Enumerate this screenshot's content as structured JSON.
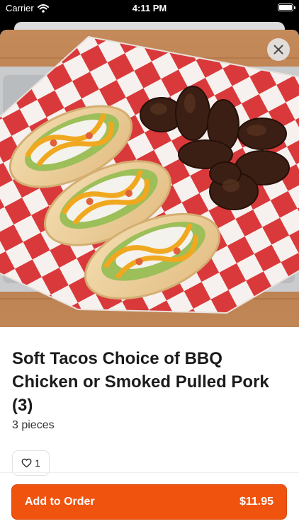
{
  "status_bar": {
    "carrier": "Carrier",
    "time": "4:11 PM"
  },
  "item": {
    "name": "Soft Tacos Choice of BBQ Chicken or Smoked Pulled Pork (3)",
    "description": "3 pieces",
    "like_count": "1"
  },
  "order_button": {
    "label": "Add to Order",
    "price": "$11.95"
  },
  "colors": {
    "accent": "#f0530e",
    "checker_red": "#d9393b"
  },
  "icons": {
    "close": "close-icon",
    "like": "heart-icon",
    "wifi": "wifi-icon",
    "battery": "battery-icon"
  }
}
